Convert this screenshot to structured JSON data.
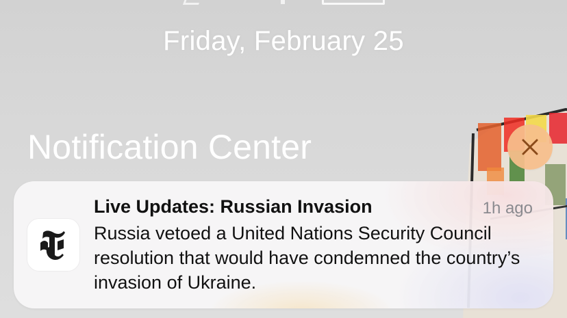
{
  "lock_screen": {
    "date": "Friday, February 25"
  },
  "notification_center": {
    "title": "Notification Center",
    "clear_button": {
      "icon": "close-icon"
    }
  },
  "notifications": [
    {
      "app_icon": "nyt-logo-icon",
      "title": "Live Updates: Russian Invasion",
      "time": "1h ago",
      "body": "Russia vetoed a United Nations Security Council resolution that would have condemned the country’s invasion of Ukraine."
    }
  ],
  "colors": {
    "clear_button_bg": "#f6be8c",
    "clear_button_glyph": "#8a4a1a",
    "text_primary": "#111111",
    "text_secondary": "#8a8a8f"
  }
}
